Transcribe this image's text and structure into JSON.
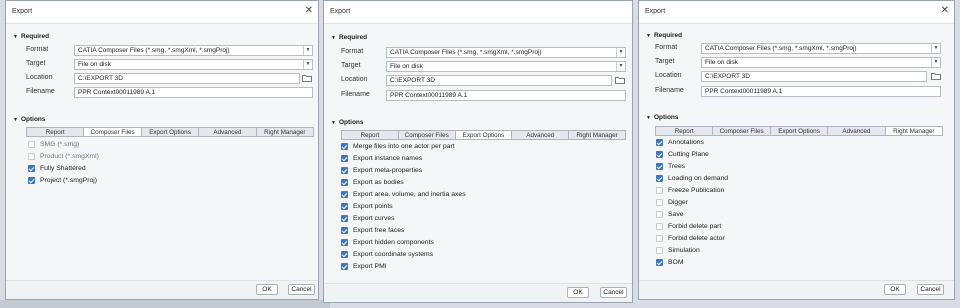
{
  "dialogs": [
    {
      "title": "Export",
      "required_label": "Required",
      "format_label": "Format",
      "format_value": "CATIA Composer Files (*.smg, *.smgXml, *.smgProj)",
      "target_label": "Target",
      "target_value": "File on disk",
      "location_label": "Location",
      "location_value": "C:\\EXPORT 3D",
      "filename_label": "Filename",
      "filename_value": "PPR Context00011989 A.1",
      "options_label": "Options",
      "tabs": [
        {
          "label": "Report"
        },
        {
          "label": "Composer Files"
        },
        {
          "label": "Export Options"
        },
        {
          "label": "Advanced"
        },
        {
          "label": "Right Manager"
        }
      ],
      "active_tab": 1,
      "options": [
        {
          "label": "SMG (*.smg)",
          "checked": false,
          "enabled": false
        },
        {
          "label": "Product (*.smgXml)",
          "checked": false,
          "enabled": false
        },
        {
          "label": "Fully Shattered",
          "checked": true,
          "enabled": true
        },
        {
          "label": "Project (*.smgProj)",
          "checked": true,
          "enabled": true
        }
      ],
      "ok_label": "OK",
      "cancel_label": "Cancel"
    },
    {
      "title": "Export",
      "required_label": "Required",
      "format_label": "Format",
      "format_value": "CATIA Composer Files (*.smg, *.smgXml, *.smgProj)",
      "target_label": "Target",
      "target_value": "File on disk",
      "location_label": "Location",
      "location_value": "C:\\EXPORT 3D",
      "filename_label": "Filename",
      "filename_value": "PPR Context00011989 A.1",
      "options_label": "Options",
      "tabs": [
        {
          "label": "Report"
        },
        {
          "label": "Composer Files"
        },
        {
          "label": "Export Options"
        },
        {
          "label": "Advanced"
        },
        {
          "label": "Right Manager"
        }
      ],
      "active_tab": 2,
      "options": [
        {
          "label": "Merge files into one actor per part",
          "checked": true,
          "enabled": true
        },
        {
          "label": "Export instance names",
          "checked": true,
          "enabled": true
        },
        {
          "label": "Export meta-properties",
          "checked": true,
          "enabled": true
        },
        {
          "label": "Export as bodies",
          "checked": true,
          "enabled": true
        },
        {
          "label": "Export area, volume, and inertia axes",
          "checked": true,
          "enabled": true
        },
        {
          "label": "Export points",
          "checked": true,
          "enabled": true
        },
        {
          "label": "Export curves",
          "checked": true,
          "enabled": true
        },
        {
          "label": "Export free faces",
          "checked": true,
          "enabled": true
        },
        {
          "label": "Export hidden components",
          "checked": true,
          "enabled": true
        },
        {
          "label": "Export coordinate systems",
          "checked": true,
          "enabled": true
        },
        {
          "label": "Export PMI",
          "checked": true,
          "enabled": true
        }
      ],
      "ok_label": "OK",
      "cancel_label": "Cancel"
    },
    {
      "title": "Export",
      "required_label": "Required",
      "format_label": "Format",
      "format_value": "CATIA Composer Files (*.smg, *.smgXml, *.smgProj)",
      "target_label": "Target",
      "target_value": "File on disk",
      "location_label": "Location",
      "location_value": "C:\\EXPORT 3D",
      "filename_label": "Filename",
      "filename_value": "PPR Context00011989 A.1",
      "options_label": "Options",
      "tabs": [
        {
          "label": "Report"
        },
        {
          "label": "Composer Files"
        },
        {
          "label": "Export Options"
        },
        {
          "label": "Advanced"
        },
        {
          "label": "Right Manager"
        }
      ],
      "active_tab": 4,
      "options": [
        {
          "label": "Annotations",
          "checked": true,
          "enabled": true
        },
        {
          "label": "Cutting Plane",
          "checked": true,
          "enabled": true
        },
        {
          "label": "Trees",
          "checked": true,
          "enabled": true
        },
        {
          "label": "Loading on demand",
          "checked": true,
          "enabled": true
        },
        {
          "label": "Freeze Publication",
          "checked": false,
          "enabled": true
        },
        {
          "label": "Digger",
          "checked": false,
          "enabled": true
        },
        {
          "label": "Save",
          "checked": false,
          "enabled": true
        },
        {
          "label": "Forbid delete part",
          "checked": false,
          "enabled": true
        },
        {
          "label": "Forbid delete actor",
          "checked": false,
          "enabled": true
        },
        {
          "label": "Simulation",
          "checked": false,
          "enabled": true
        },
        {
          "label": "BOM",
          "checked": true,
          "enabled": true
        }
      ],
      "ok_label": "OK",
      "cancel_label": "Cancel"
    }
  ]
}
